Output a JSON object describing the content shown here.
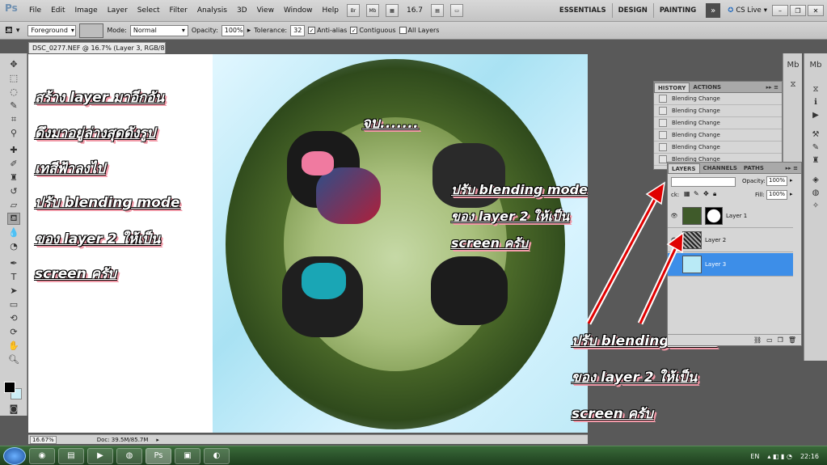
{
  "app": {
    "logo": "Ps"
  },
  "menu": [
    "File",
    "Edit",
    "Image",
    "Layer",
    "Select",
    "Filter",
    "Analysis",
    "3D",
    "View",
    "Window",
    "Help"
  ],
  "menubar_buttons": {
    "bridge": "Br",
    "minibridge": "Mb",
    "zoom_value": "16.7"
  },
  "workspaces": [
    "ESSENTIALS",
    "DESIGN",
    "PAINTING"
  ],
  "cs_live": "CS Live",
  "options": {
    "fill_source": "Foreground",
    "mode_label": "Mode:",
    "mode_value": "Normal",
    "opacity_label": "Opacity:",
    "opacity_value": "100%",
    "tolerance_label": "Tolerance:",
    "tolerance_value": "32",
    "antialias_label": "Anti-alias",
    "contiguous_label": "Contiguous",
    "all_layers_label": "All Layers"
  },
  "document": {
    "tab_title": "DSC_0277.NEF @ 16.7% (Layer 3, RGB/8) *"
  },
  "annotations": {
    "left": [
      "สร้าง layer มาอีกอัน",
      "ดึงมาอยู่ล่างสุดดังรูป",
      "เทสีฟ้าลงไป",
      "ปรับ blending mode",
      "ของ layer 2 ให้เป็น",
      "screen ครับ"
    ],
    "center": "จบ.......",
    "middle": [
      "ปรับ  blending  mode",
      "ของ  layer  2  ให้เป็น",
      "screen  ครับ"
    ],
    "bottom_right": [
      "ปรับ blending mode",
      "ของ layer 2 ให้เป็น",
      "screen ครับ"
    ]
  },
  "history": {
    "tabs": [
      "HISTORY",
      "ACTIONS"
    ],
    "items": [
      "Blending Change",
      "Blending Change",
      "Blending Change",
      "Blending Change",
      "Blending Change",
      "Blending Change"
    ]
  },
  "layers": {
    "tabs": [
      "LAYERS",
      "CHANNELS",
      "PATHS"
    ],
    "opacity_label": "Opacity:",
    "opacity_value": "100%",
    "lock_label": "ck:",
    "fill_label": "Fill:",
    "fill_value": "100%",
    "items": [
      {
        "name": "Layer 1"
      },
      {
        "name": "Layer 2"
      },
      {
        "name": "Layer 3"
      }
    ]
  },
  "status": {
    "zoom": "16.67%",
    "doc": "Doc: 39.5M/85.7M"
  },
  "taskbar": {
    "language": "EN",
    "time": "22:16"
  },
  "colors": {
    "annotation_shadow": "#f19aa8",
    "arrow": "#e00000",
    "selected_layer": "#3d8ee8",
    "layer3_fill": "#b9eaf6"
  }
}
